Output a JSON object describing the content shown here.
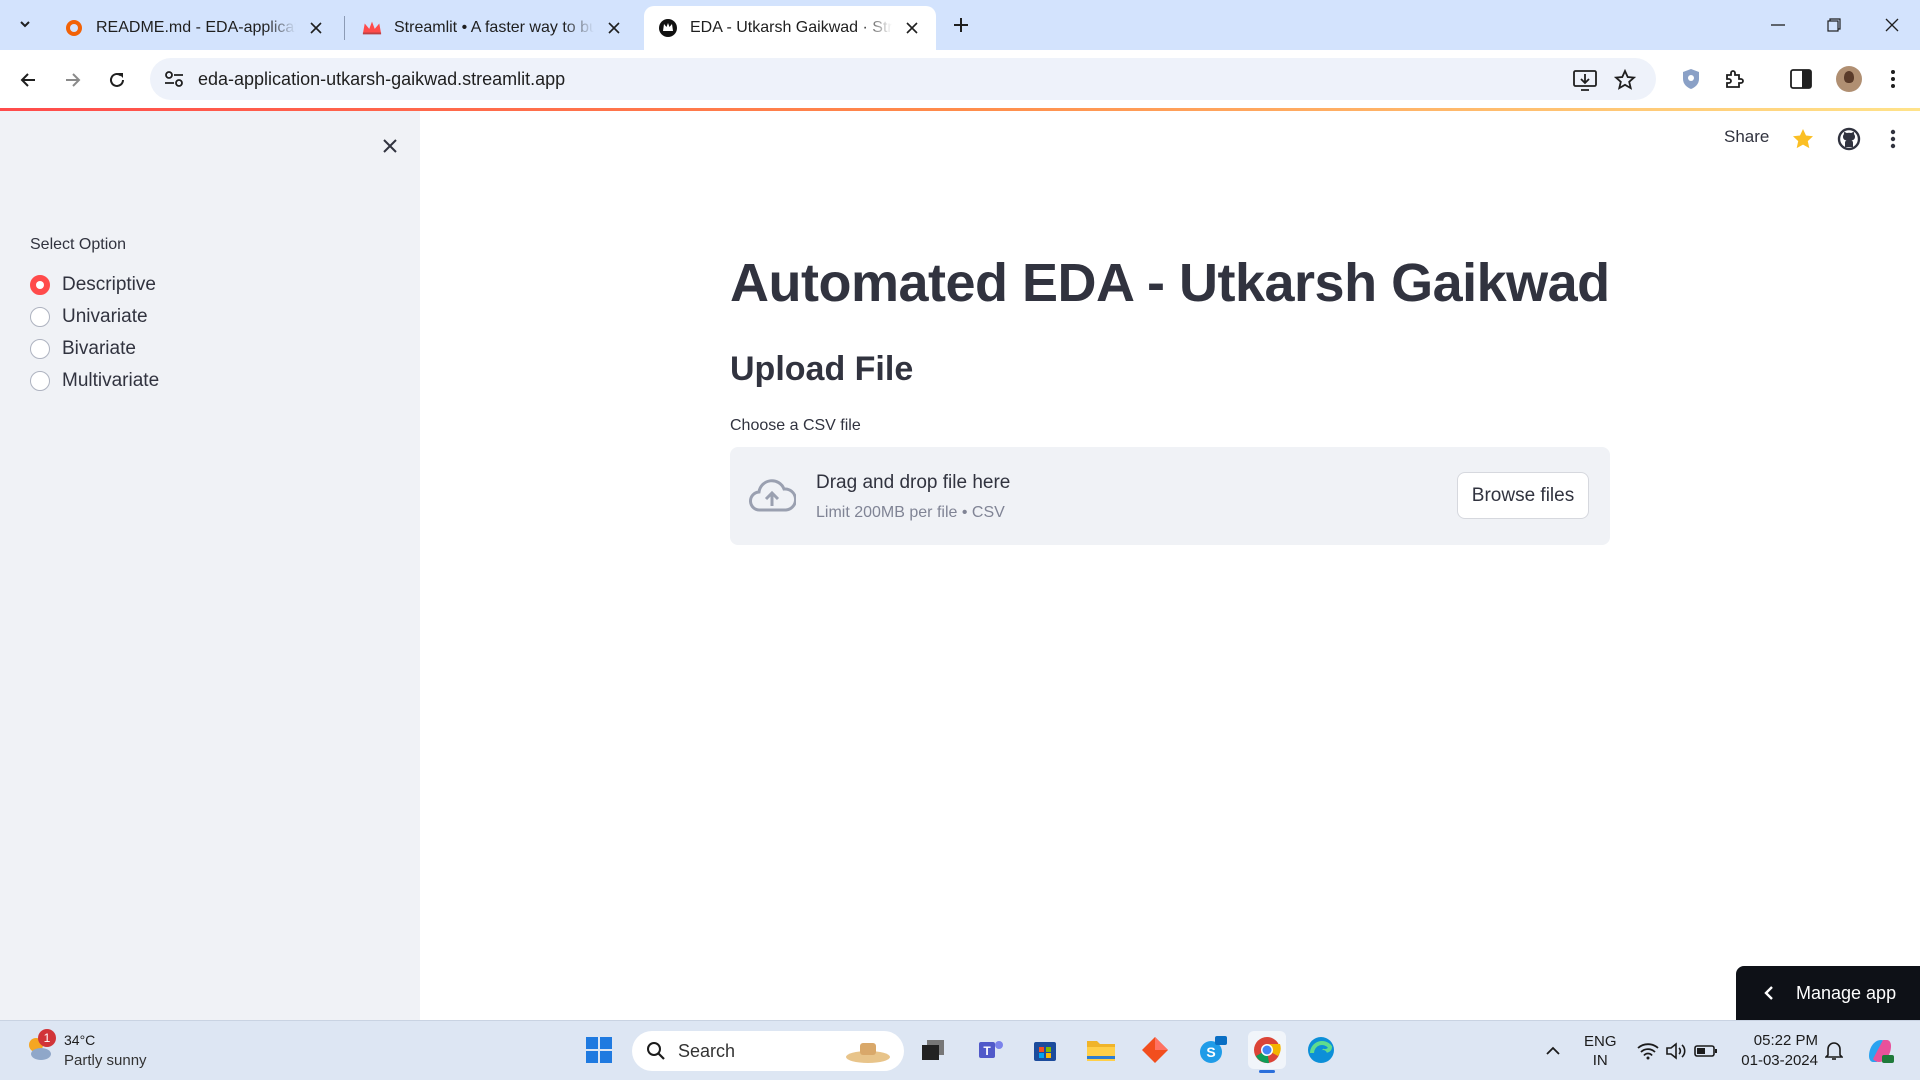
{
  "browser": {
    "tabs": [
      {
        "title": "README.md - EDA-application",
        "favicon": "replit-icon"
      },
      {
        "title": "Streamlit • A faster way to build",
        "favicon": "streamlit-crown-icon"
      },
      {
        "title": "EDA - Utkarsh Gaikwad · Stream",
        "favicon": "streamlit-app-icon",
        "active": true
      }
    ],
    "url": "eda-application-utkarsh-gaikwad.streamlit.app"
  },
  "sidebar": {
    "radio_label": "Select Option",
    "options": [
      "Descriptive",
      "Univariate",
      "Bivariate",
      "Multivariate"
    ],
    "selected": "Descriptive"
  },
  "header": {
    "share_label": "Share"
  },
  "main": {
    "title": "Automated EDA - Utkarsh Gaikwad",
    "subtitle": "Upload File",
    "uploader": {
      "label": "Choose a CSV file",
      "drop_text": "Drag and drop file here",
      "limit_text": "Limit 200MB per file • CSV",
      "browse_label": "Browse files"
    }
  },
  "manage_app_label": "Manage app",
  "taskbar": {
    "weather": {
      "badge": "1",
      "temp": "34°C",
      "desc": "Partly sunny"
    },
    "search_label": "Search",
    "lang_line1": "ENG",
    "lang_line2": "IN",
    "time": "05:22 PM",
    "date": "01-03-2024"
  },
  "colors": {
    "accent": "#ff4b4b",
    "sidebar_bg": "#f0f2f6",
    "tabbar_bg": "#d3e3fd",
    "text": "#31333f"
  }
}
